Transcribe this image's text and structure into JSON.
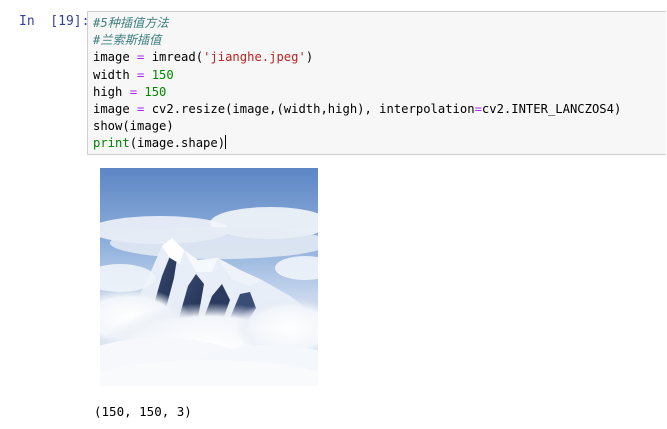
{
  "cell": {
    "prompt": "In  [19]:",
    "code": [
      [
        {
          "t": "#5种插值方法",
          "c": "cm"
        }
      ],
      [
        {
          "t": "#兰索斯插值",
          "c": "cm"
        }
      ],
      [
        {
          "t": "image "
        },
        {
          "t": "=",
          "c": "op"
        },
        {
          "t": " imread("
        },
        {
          "t": "'jianghe.jpeg'",
          "c": "str"
        },
        {
          "t": ")"
        }
      ],
      [
        {
          "t": "width "
        },
        {
          "t": "=",
          "c": "op"
        },
        {
          "t": " "
        },
        {
          "t": "150",
          "c": "num"
        }
      ],
      [
        {
          "t": "high "
        },
        {
          "t": "=",
          "c": "op"
        },
        {
          "t": " "
        },
        {
          "t": "150",
          "c": "num"
        }
      ],
      [
        {
          "t": "image "
        },
        {
          "t": "=",
          "c": "op"
        },
        {
          "t": " cv2.resize(image,(width,high), interpolation"
        },
        {
          "t": "=",
          "c": "op"
        },
        {
          "t": "cv2.INTER_LANCZOS4)"
        }
      ],
      [
        {
          "t": "show(image)"
        }
      ],
      [
        {
          "t": "print",
          "c": "kw"
        },
        {
          "t": "(image.shape)"
        }
      ]
    ]
  },
  "output": {
    "image_description_icon": "mountain-photo",
    "text": "(150, 150, 3)"
  },
  "colors": {
    "prompt": "#303f9f",
    "comment": "#408080",
    "operator": "#aa22ff",
    "number": "#008800",
    "string": "#ba2121",
    "builtin": "#008000",
    "cell_bg": "#f7f7f7",
    "cell_border": "#cfcfcf"
  }
}
